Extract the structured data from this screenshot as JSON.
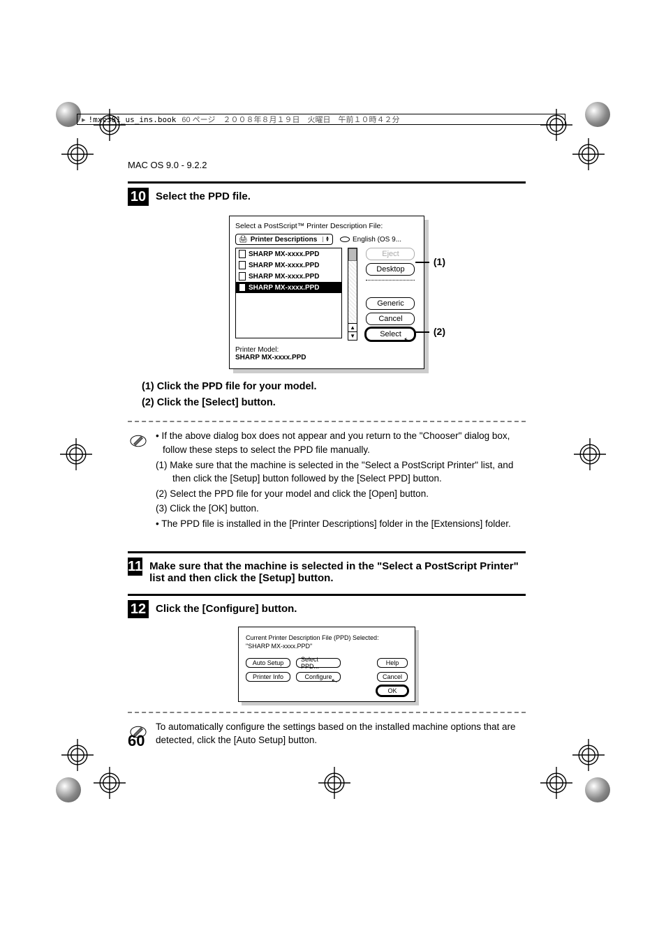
{
  "header": {
    "filename": "!mxc381_us_ins.book",
    "meta": "60 ページ　２００８年８月１９日　火曜日　午前１０時４２分"
  },
  "section_title": "MAC OS 9.0 - 9.2.2",
  "step10": {
    "num": "10",
    "title": "Select the PPD file.",
    "dialog": {
      "prompt": "Select a PostScript™ Printer Description File:",
      "dropdown": "Printer Descriptions",
      "disk": "English (OS 9...",
      "files": [
        "SHARP MX-xxxx.PPD",
        "SHARP MX-xxxx.PPD",
        "SHARP MX-xxxx.PPD",
        "SHARP MX-xxxx.PPD"
      ],
      "buttons": {
        "eject": "Eject",
        "desktop": "Desktop",
        "generic": "Generic",
        "cancel": "Cancel",
        "select": "Select"
      },
      "model_label": "Printer Model:",
      "model_value": "SHARP MX-xxxx.PPD"
    },
    "callouts": {
      "c1": "(1)",
      "c2": "(2)"
    },
    "sub1": "(1) Click the PPD file for your model.",
    "sub2": "(2) Click the [Select] button.",
    "note": {
      "b1": "If the above dialog box does not appear and you return to the \"Chooser\" dialog box, follow these steps to select the PPD file manually.",
      "n1": "(1) Make sure that the machine is selected in the \"Select a PostScript Printer\" list, and then click the [Setup] button followed by the [Select PPD] button.",
      "n2": "(2) Select the PPD file for your model and click the [Open] button.",
      "n3": "(3) Click the [OK] button.",
      "b2": "The PPD file is installed in the [Printer Descriptions] folder in the [Extensions] folder."
    }
  },
  "step11": {
    "num": "11",
    "title": "Make sure that the machine is selected in the \"Select a PostScript Printer\" list and then click the [Setup] button."
  },
  "step12": {
    "num": "12",
    "title": "Click the [Configure] button.",
    "dialog": {
      "line1": "Current Printer Description File (PPD) Selected:",
      "line2": "\"SHARP MX-xxxx.PPD\"",
      "buttons": {
        "auto": "Auto Setup",
        "selectppd": "Select PPD...",
        "printerinfo": "Printer Info",
        "configure": "Configure",
        "help": "Help",
        "cancel": "Cancel",
        "ok": "OK"
      }
    },
    "note": "To automatically configure the settings based on the installed machine options that are detected, click the [Auto Setup] button."
  },
  "page_number": "60"
}
